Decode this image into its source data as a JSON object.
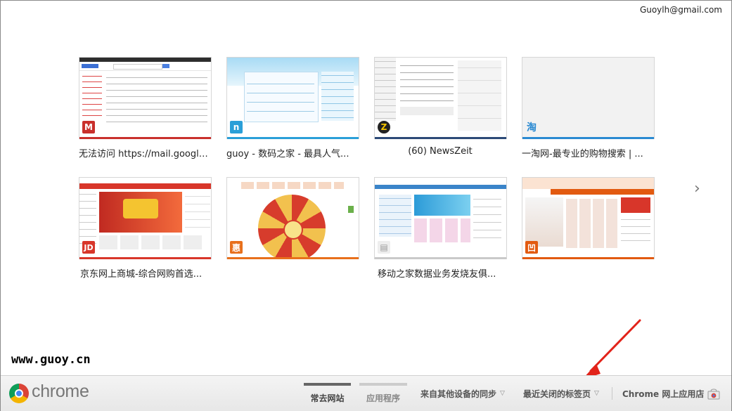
{
  "account": "Guoylh@gmail.com",
  "tiles": [
    {
      "title": "无法访问 https://mail.google...",
      "favicon": "M",
      "favicon_color": "#c9302c",
      "bar_color": "#c9302c"
    },
    {
      "title": "guoy - 数码之家 - 最具人气...",
      "favicon": "n",
      "favicon_color": "#2a9fd8",
      "bar_color": "#2a9fd8"
    },
    {
      "title": "(60) NewsZeit",
      "favicon": "Z",
      "favicon_color": "#222222",
      "bar_color": "#2c4a77"
    },
    {
      "title": "一淘网-最专业的购物搜索 | ...",
      "favicon": "淘",
      "favicon_color": "#2a8ad2",
      "bar_color": "#2a8ad2"
    },
    {
      "title": "京东网上商城-综合网购首选...",
      "favicon": "JD",
      "favicon_color": "#d8362a",
      "bar_color": "#d8362a"
    },
    {
      "title": "",
      "favicon": "惠",
      "favicon_color": "#e8701c",
      "bar_color": "#e8701c"
    },
    {
      "title": "移动之家数据业务发烧友俱...",
      "favicon": "▤",
      "favicon_color": "#bbbbbb",
      "bar_color": "#c9c9c9"
    },
    {
      "title": "",
      "favicon": "凹",
      "favicon_color": "#e25a10",
      "bar_color": "#e25a10"
    }
  ],
  "next_arrow": "›",
  "watermark": "www.guoy.cn",
  "footer": {
    "logo_text": "chrome",
    "tabs": [
      {
        "label": "常去网站",
        "active": true
      },
      {
        "label": "应用程序",
        "active": false
      }
    ],
    "menus": [
      {
        "label": "来自其他设备的同步",
        "caret": "▽"
      },
      {
        "label": "最近关闭的标签页",
        "caret": "▽"
      }
    ],
    "webstore_label": "Chrome 网上应用店"
  },
  "annotation_color": "#e2231a"
}
